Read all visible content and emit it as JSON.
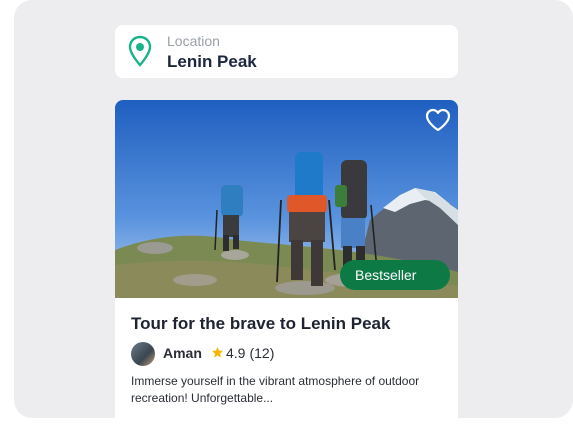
{
  "location": {
    "label": "Location",
    "value": "Lenin Peak",
    "icon": "map-pin-icon",
    "icon_color": "#18b38a"
  },
  "tour": {
    "badge": "Bestseller",
    "badge_color": "#0d7a46",
    "title": "Tour for the brave to Lenin Peak",
    "author": "Aman",
    "rating": "4.9",
    "reviews": "(12)",
    "star_color": "#f5b800",
    "description": "Immerse yourself in the vibrant atmosphere of outdoor recreation! Unforgettable...",
    "favorite_icon": "heart-outline-icon"
  }
}
